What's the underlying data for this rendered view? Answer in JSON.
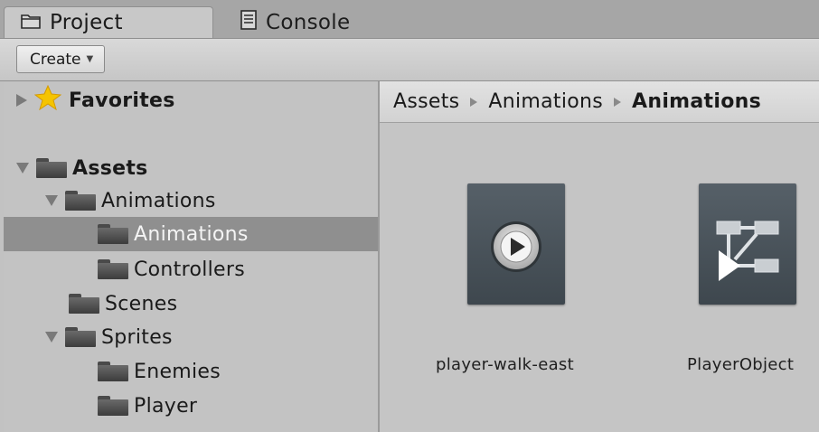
{
  "tabs": {
    "project": "Project",
    "console": "Console"
  },
  "toolbar": {
    "create_label": "Create"
  },
  "tree": {
    "favorites": "Favorites",
    "assets": "Assets",
    "animations": "Animations",
    "animations_sub": "Animations",
    "controllers": "Controllers",
    "scenes": "Scenes",
    "sprites": "Sprites",
    "enemies": "Enemies",
    "player": "Player"
  },
  "breadcrumb": [
    "Assets",
    "Animations",
    "Animations"
  ],
  "assets": [
    {
      "label": "player-walk-east",
      "icon": "animation-clip-icon"
    },
    {
      "label": "PlayerObject",
      "icon": "animator-controller-icon"
    }
  ],
  "colors": {
    "selection": "#8f8f8f",
    "panel": "#c3c3c3",
    "thumb": "#4c555c",
    "star": "#f5c400"
  }
}
